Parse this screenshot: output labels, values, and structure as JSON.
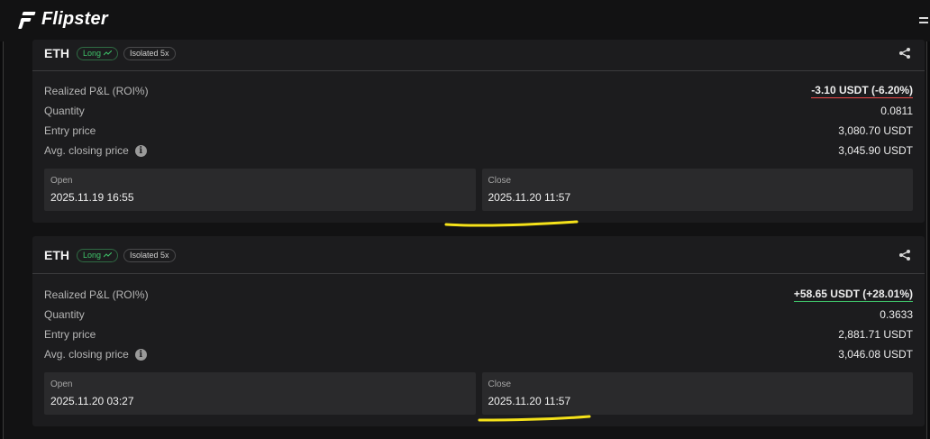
{
  "app": {
    "name": "Flipster"
  },
  "trades": [
    {
      "symbol": "ETH",
      "direction": "Long",
      "margin": "Isolated 5x",
      "rows": {
        "pnl_label": "Realized P&L (ROI%)",
        "pnl_value": "-3.10 USDT (-6.20%)",
        "quantity_label": "Quantity",
        "quantity_value": "0.0811",
        "entry_label": "Entry price",
        "entry_value": "3,080.70 USDT",
        "avg_close_label": "Avg. closing price",
        "avg_close_value": "3,045.90 USDT"
      },
      "open_label": "Open",
      "open_time": "2025.11.19 16:55",
      "close_label": "Close",
      "close_time": "2025.11.20 11:57"
    },
    {
      "symbol": "ETH",
      "direction": "Long",
      "margin": "Isolated 5x",
      "rows": {
        "pnl_label": "Realized P&L (ROI%)",
        "pnl_value": "+58.65 USDT (+28.01%)",
        "quantity_label": "Quantity",
        "quantity_value": "0.3633",
        "entry_label": "Entry price",
        "entry_value": "2,881.71 USDT",
        "avg_close_label": "Avg. closing price",
        "avg_close_value": "3,046.08 USDT"
      },
      "open_label": "Open",
      "open_time": "2025.11.20 03:27",
      "close_label": "Close",
      "close_time": "2025.11.20 11:57"
    }
  ],
  "colors": {
    "loss": "#ef4a4a",
    "profit": "#3fc46a",
    "highlight_mark": "#f5e21a"
  },
  "icons": [
    "flipster-logo-icon",
    "menu-icon",
    "share-icon",
    "info-icon",
    "trend-up-icon"
  ]
}
